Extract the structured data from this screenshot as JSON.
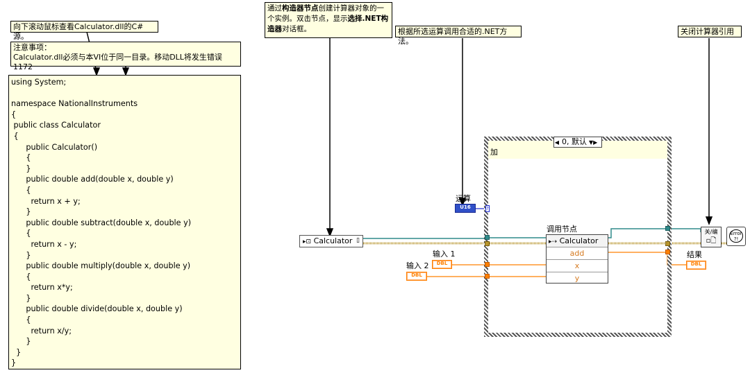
{
  "notes": {
    "scroll_hint": "向下滚动鼠标查看Calculator.dll的C#源。",
    "warning_title": "注意事项：",
    "warning_text": "Calculator.dll必须与本VI位于同一目录。移动DLL将发生错误1172",
    "constructor_note_a": "通过",
    "constructor_note_b": "构造器节点",
    "constructor_note_c": "创建计算器对象的一个实例。双击节点，显示",
    "constructor_note_d": "选择.NET构造器",
    "constructor_note_e": "对话框。",
    "method_note": "根据所选运算调用合适的.NET方法。",
    "close_note": "关闭计算器引用"
  },
  "code_lines": [
    "using System;",
    "",
    "namespace NationalInstruments",
    "{",
    " public class Calculator",
    " {",
    "      public Calculator()",
    "      {",
    "      }",
    "      public double add(double x, double y)",
    "      {",
    "        return x + y;",
    "      }",
    "      public double subtract(double x, double y)",
    "      {",
    "        return x - y;",
    "      }",
    "      public double multiply(double x, double y)",
    "      {",
    "        return x*y;",
    "      }",
    "      public double divide(double x, double y)",
    "      {",
    "        return x/y;",
    "      }",
    "  }",
    "}"
  ],
  "diagram": {
    "constructor_label": "Calculator",
    "case_selector": "0, 默认",
    "case_label": "加",
    "operation_label": "运算",
    "operation_type": "U16",
    "input1_label": "输入 1",
    "input2_label": "输入 2",
    "dbl_type": "DBL",
    "invoke_caption": "调用节点",
    "invoke_class": "Calculator",
    "invoke_method": "add",
    "invoke_params": [
      "x",
      "y"
    ],
    "result_label": "结果",
    "close_node_text": "关/编",
    "error_glyph": "Error ?!"
  },
  "colors": {
    "refnum_wire": "#2f8a8a",
    "error_wire": "#c9a23a",
    "dbl_wire": "#ff8000",
    "u16_wire": "#1a2ad0",
    "note_bg": "#ffffe1"
  }
}
